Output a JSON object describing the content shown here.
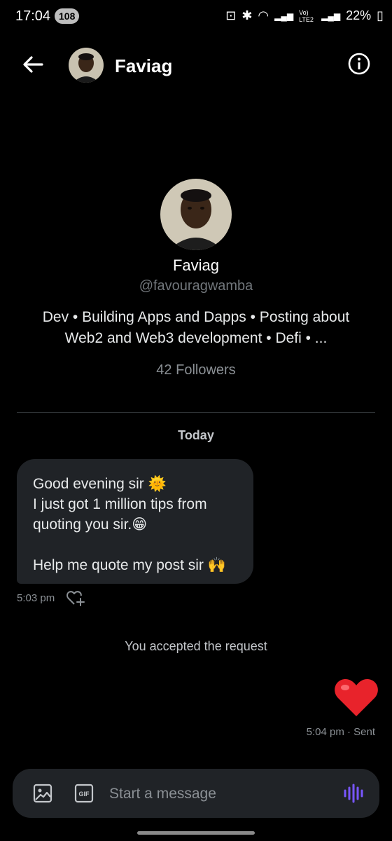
{
  "status_bar": {
    "time": "17:04",
    "badge": "108",
    "network": "Vo) LTE2",
    "battery": "22%"
  },
  "header": {
    "name": "Faviag",
    "back_icon": "arrow-left-icon",
    "info_icon": "info-circle-icon"
  },
  "profile": {
    "name": "Faviag",
    "handle": "@favouragwamba",
    "bio": "Dev • Building Apps and Dapps • Posting about Web2 and Web3 development • Defi • ...",
    "followers": "42 Followers"
  },
  "conversation": {
    "date_separator": "Today",
    "received": {
      "text": "Good evening sir 🌞\nI just got 1 million tips from quoting you sir.😁\n\nHelp me quote my post sir 🙌",
      "time": "5:03 pm"
    },
    "system_message": "You accepted the request",
    "sent": {
      "content": "❤️",
      "meta": "5:04 pm · Sent"
    }
  },
  "composer": {
    "placeholder": "Start a message",
    "gif_label": "GIF"
  },
  "colors": {
    "background": "#000000",
    "bubble": "#202327",
    "muted_text": "#71767b",
    "voice_accent": "#7856ff",
    "heart": "#e8232b"
  }
}
